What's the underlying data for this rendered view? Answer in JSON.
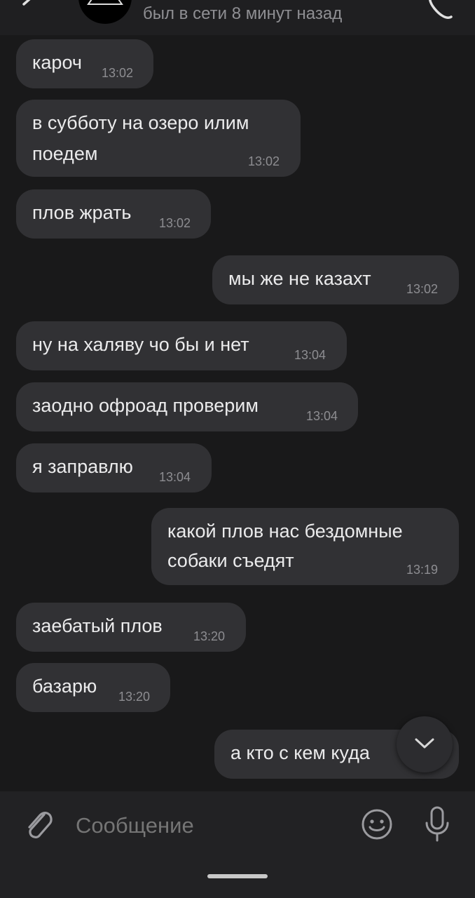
{
  "header": {
    "status": "был в сети 8 минут назад"
  },
  "messages": [
    {
      "text": "кароч",
      "time": "13:02",
      "outgoing": false
    },
    {
      "text_lines": [
        "в субботу на озеро илим",
        "поедем"
      ],
      "time": "13:02",
      "outgoing": false
    },
    {
      "text": "плов жрать",
      "time": "13:02",
      "outgoing": false
    },
    {
      "text": "мы же не казахт",
      "time": "13:02",
      "outgoing": true
    },
    {
      "text": "ну на халяву чо бы и нет",
      "time": "13:04",
      "outgoing": false
    },
    {
      "text": "заодно офроад проверим",
      "time": "13:04",
      "outgoing": false
    },
    {
      "text": "я заправлю",
      "time": "13:04",
      "outgoing": false
    },
    {
      "text_lines": [
        "какой плов нас бездомные",
        "собаки съедят"
      ],
      "time": "13:19",
      "outgoing": true
    },
    {
      "text": "заебатый плов",
      "time": "13:20",
      "outgoing": false
    },
    {
      "text": "базарю",
      "time": "13:20",
      "outgoing": false
    },
    {
      "text": "а кто с кем куда",
      "time": "",
      "outgoing": true
    }
  ],
  "composer": {
    "placeholder": "Сообщение"
  },
  "colors": {
    "background": "#19191a",
    "bubble": "#313134",
    "composer": "#222224"
  },
  "icons": [
    "back-arrow-icon",
    "avatar",
    "phone-icon",
    "chevron-down-icon",
    "paperclip-icon",
    "emoji-icon",
    "microphone-icon"
  ]
}
